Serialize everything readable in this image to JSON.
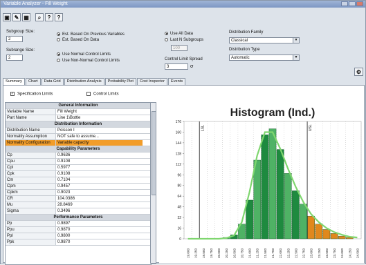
{
  "window": {
    "title": "Variable Analyzer - Fill Weight"
  },
  "toolbar": {
    "icons": [
      "save-icon",
      "tools-icon",
      "grid-icon",
      "search-icon",
      "help-icon"
    ]
  },
  "settings": {
    "subgroup_size_label": "Subgroup Size:",
    "subgroup_size_value": "2",
    "subrange_size_label": "Subrange Size:",
    "subrange_size_value": "2",
    "est_previous": "Est. Based On Previous Variables",
    "est_data": "Est. Based On Data",
    "normal_limits": "Use Normal Control Limits",
    "nonnormal_limits": "Use Non-Normal Control Limits",
    "use_all_data": "Use All Data",
    "last_n_subgroups": "Last N Subgroups",
    "last_n_value": "100",
    "control_limit_spread_label": "Control Limit Spread",
    "control_limit_spread_value": "3",
    "sigma_symbol": "σ",
    "distribution_family_label": "Distribution Family",
    "distribution_family_value": "Classical",
    "distribution_type_label": "Distribution Type",
    "distribution_type_value": "Automatic"
  },
  "tabs": [
    "Summary",
    "Chart",
    "Data Grid",
    "Distribution Analysis",
    "Probability Plot",
    "Cost Inspector",
    "Events"
  ],
  "checks": {
    "spec_limits": "Specification Limits",
    "control_limits": "Control Limits"
  },
  "table": [
    {
      "type": "header",
      "label": "General Information"
    },
    {
      "k": "Variable Name",
      "v": "Fill Weight"
    },
    {
      "k": "Part Name",
      "v": "Line 1\\Bottle"
    },
    {
      "type": "header",
      "label": "Distribution Information"
    },
    {
      "k": "Distribution Name",
      "v": "Poisson I"
    },
    {
      "k": "Normality Assumption",
      "v": "NOT safe to assume..."
    },
    {
      "k": "Normality Configuration",
      "v": "Variable capacity",
      "hl": true
    },
    {
      "type": "header",
      "label": "Capability Parameters"
    },
    {
      "k": "Cp",
      "v": "0.9636"
    },
    {
      "k": "Cpu",
      "v": "0.9108"
    },
    {
      "k": "Cpl",
      "v": "0.5977"
    },
    {
      "k": "Cpk",
      "v": "0.9108"
    },
    {
      "k": "Cm",
      "v": "0.7104"
    },
    {
      "k": "Cpm",
      "v": "0.9457"
    },
    {
      "k": "Cpkm",
      "v": "0.9023"
    },
    {
      "k": "CR",
      "v": "104.0386"
    },
    {
      "k": "Mu",
      "v": "28.8469"
    },
    {
      "k": "Sigma",
      "v": "0.3496"
    },
    {
      "type": "header",
      "label": "Performance Parameters"
    },
    {
      "k": "Pp",
      "v": "0.9897"
    },
    {
      "k": "Ppu",
      "v": "0.9870"
    },
    {
      "k": "Ppl",
      "v": "0.9800"
    },
    {
      "k": "Ppk",
      "v": "0.9870"
    }
  ],
  "chart_data": {
    "type": "bar",
    "title": "Histogram (Ind.)",
    "ylim": [
      0,
      176
    ],
    "yticks": [
      "176",
      "160",
      "144",
      "128",
      "112",
      "96",
      "80",
      "64",
      "48",
      "32",
      "16",
      "0"
    ],
    "spec_lines": [
      "LSL",
      "USL"
    ],
    "categories": [
      "19.000",
      "19.250",
      "19.500",
      "19.750",
      "20.000",
      "20.250",
      "20.500",
      "20.750",
      "21.000",
      "21.250",
      "21.500",
      "21.750",
      "22.000",
      "22.250",
      "22.500",
      "22.750",
      "23.000",
      "23.250",
      "23.500",
      "23.750",
      "24.000",
      "24.250",
      "24.500"
    ],
    "values": [
      0,
      0,
      0,
      0,
      0,
      2,
      6,
      22,
      58,
      118,
      156,
      165,
      134,
      98,
      72,
      52,
      34,
      22,
      14,
      8,
      4,
      2,
      0
    ],
    "fit_curve": [
      0,
      0,
      0,
      0,
      0,
      1,
      5,
      25,
      70,
      125,
      160,
      160,
      135,
      105,
      78,
      55,
      37,
      25,
      16,
      10,
      6,
      3,
      2
    ],
    "colors": {
      "in_spec": "#1e8a3f",
      "in_spec_light": "#4fb265",
      "out_spec": "#e0881d",
      "curve": "#7fd66f",
      "title": "#222222"
    }
  }
}
